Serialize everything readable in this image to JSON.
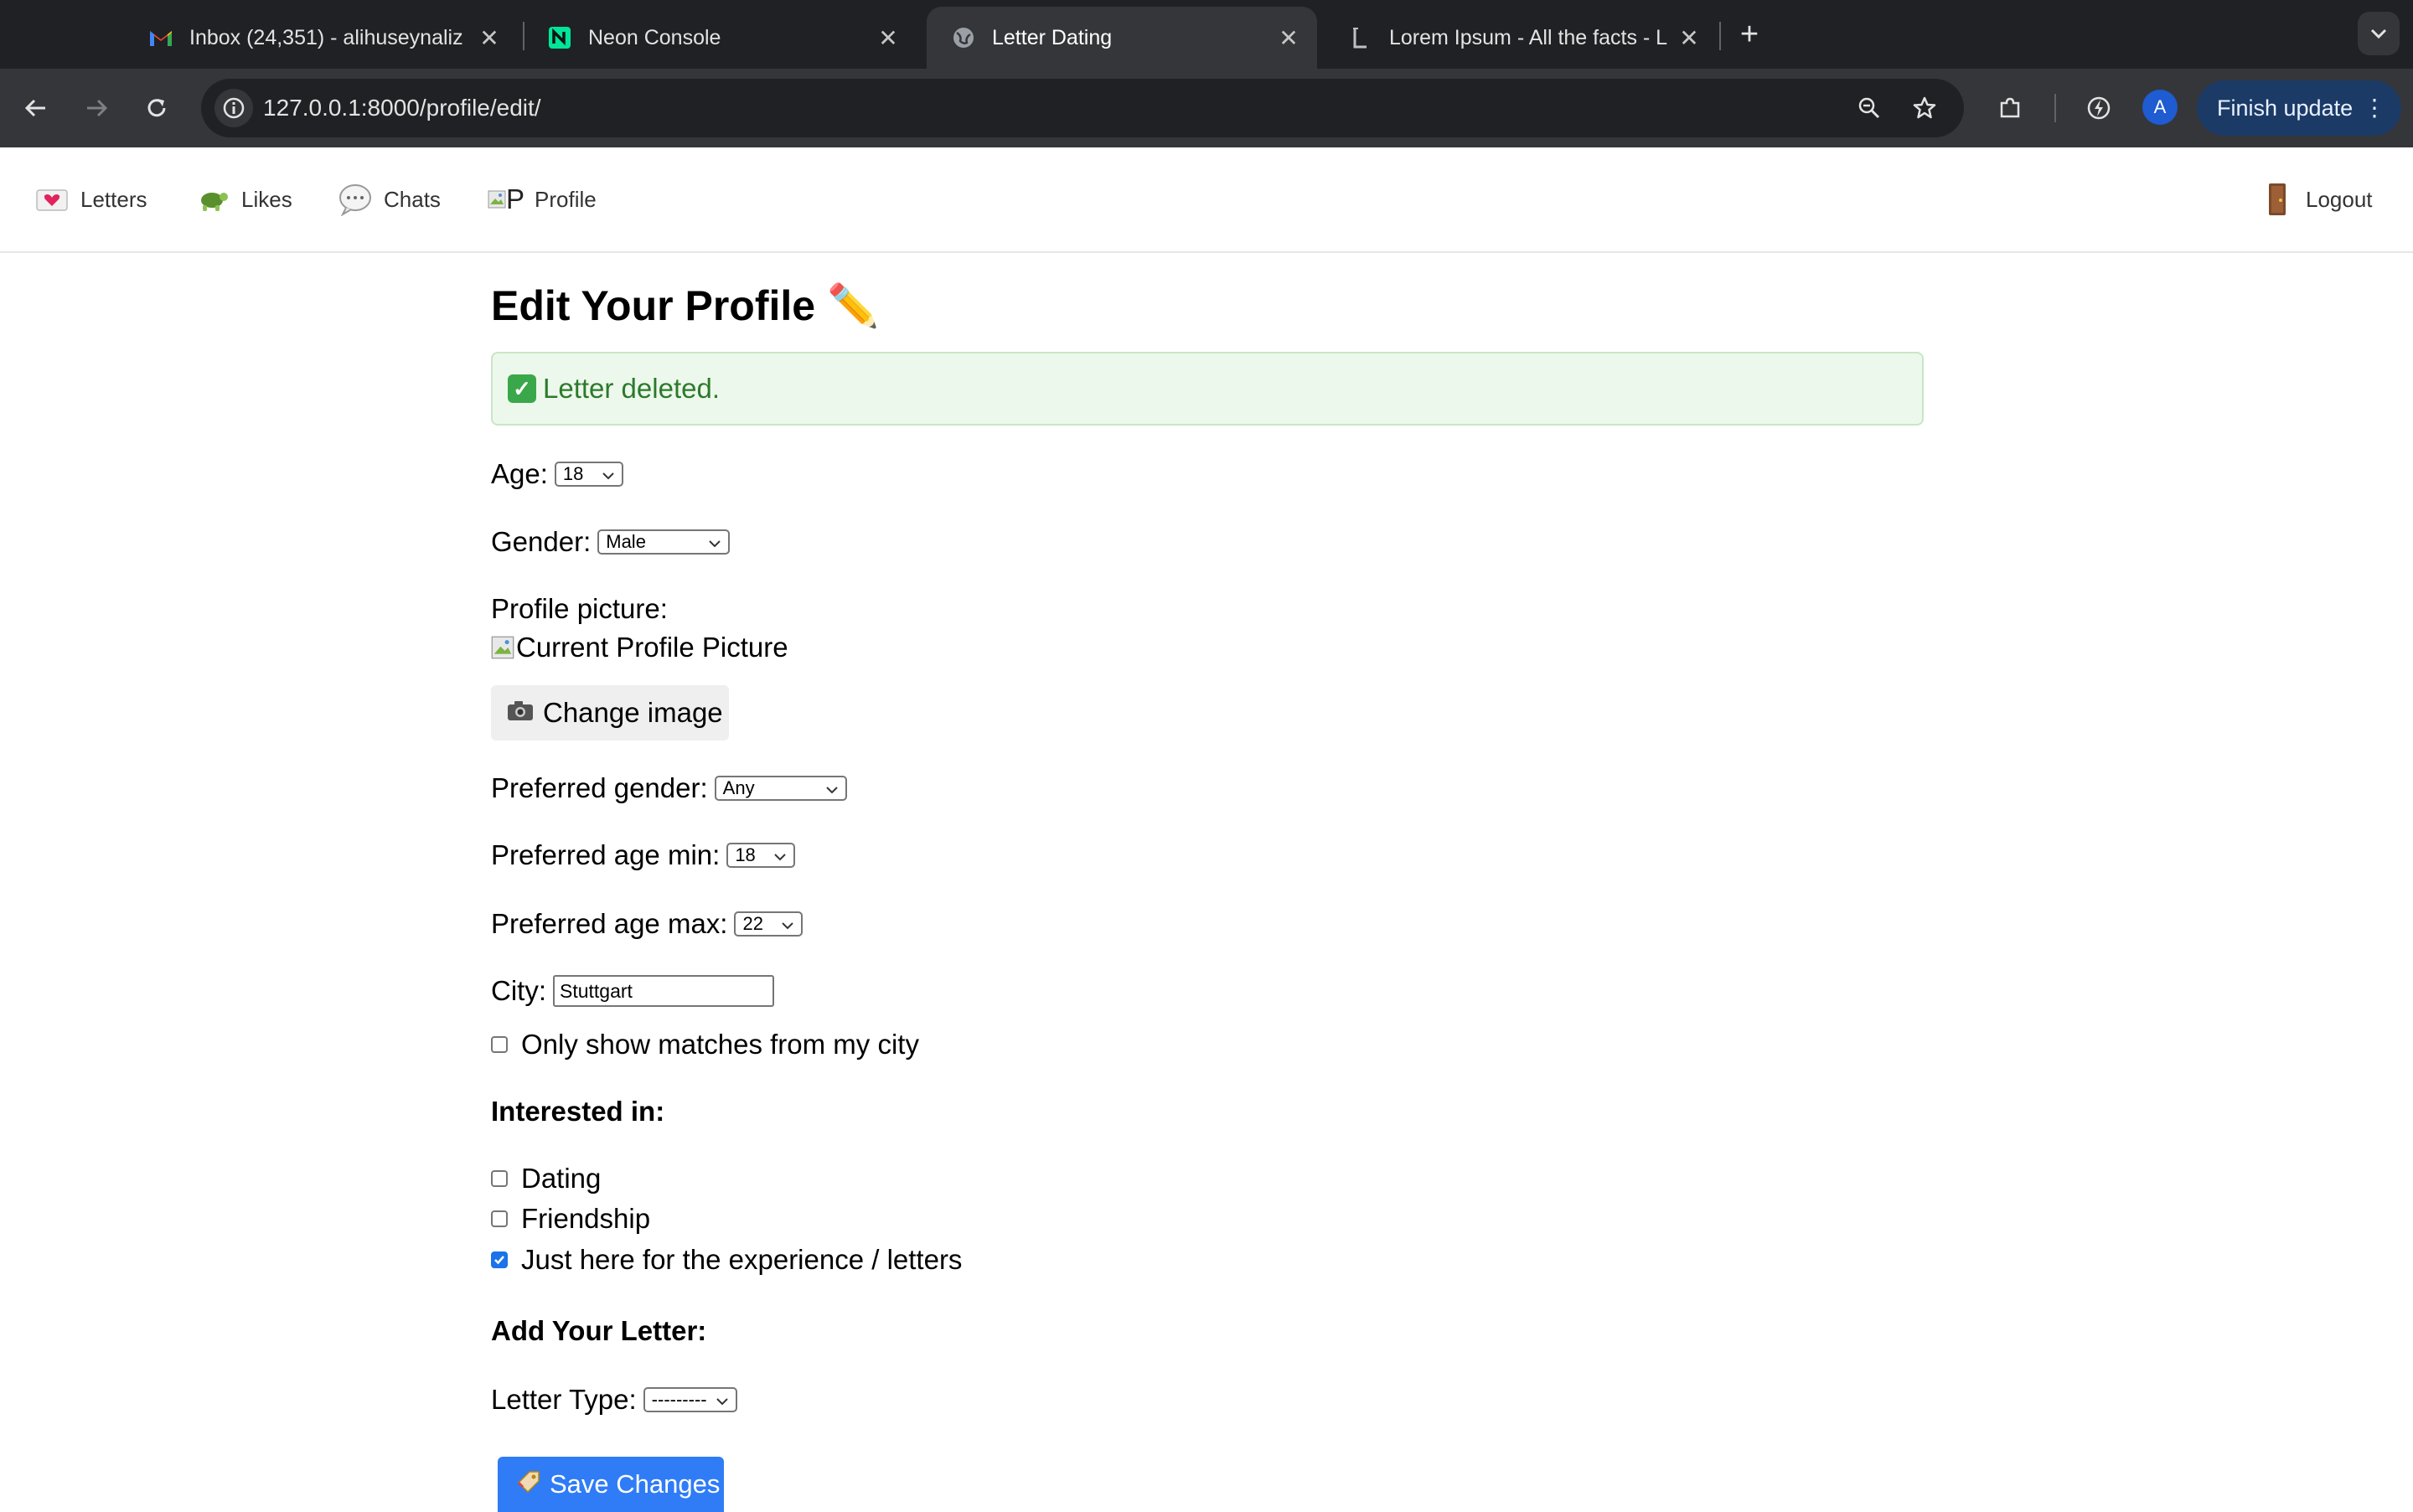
{
  "browser": {
    "tabs": [
      {
        "title": "Inbox (24,351) - alihuseynaliz",
        "icon": "gmail-icon"
      },
      {
        "title": "Neon Console",
        "icon": "neon-icon"
      },
      {
        "title": "Letter Dating",
        "icon": "globe-icon"
      },
      {
        "title": "Lorem Ipsum - All the facts - L",
        "icon": "lorem-icon"
      }
    ],
    "active_tab": 2,
    "url": "127.0.0.1:8000/profile/edit/",
    "profile_initial": "A",
    "finish_update_label": "Finish update"
  },
  "nav": {
    "letters": "Letters",
    "likes": "Likes",
    "chats": "Chats",
    "profile": "Profile",
    "profile_img_alt": "P",
    "logout": "Logout"
  },
  "page": {
    "title": "Edit Your Profile ✏️",
    "alert_icon": "✓",
    "alert": "Letter deleted.",
    "age_label": "Age:",
    "age_value": "18",
    "gender_label": "Gender:",
    "gender_value": "Male",
    "picture_label": "Profile picture:",
    "picture_alt": "Current Profile Picture",
    "change_image": "Change image",
    "pref_gender_label": "Preferred gender:",
    "pref_gender_value": "Any",
    "pref_min_label": "Preferred age min:",
    "pref_min_value": "18",
    "pref_max_label": "Preferred age max:",
    "pref_max_value": "22",
    "city_label": "City:",
    "city_value": "Stuttgart",
    "only_city_label": "Only show matches from my city",
    "only_city_checked": false,
    "interested_heading": "Interested in:",
    "interests": [
      {
        "label": "Dating",
        "checked": false
      },
      {
        "label": "Friendship",
        "checked": false
      },
      {
        "label": "Just here for the experience / letters",
        "checked": true
      }
    ],
    "add_letter_heading": "Add Your Letter:",
    "letter_type_label": "Letter Type:",
    "letter_type_value": "---------",
    "save_label": "Save Changes"
  },
  "colors": {
    "accent": "#2f7cf6",
    "alert_bg": "#edf8ec",
    "alert_text": "#2c7a2c",
    "chrome_dark": "#202124",
    "chrome_toolbar": "#35363a"
  }
}
